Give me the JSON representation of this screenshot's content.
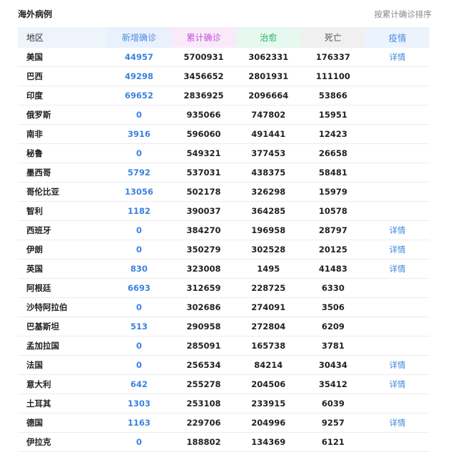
{
  "header": {
    "title": "海外病例",
    "sort_label": "按累计确诊排序"
  },
  "columns": {
    "region": "地区",
    "new": "新增确诊",
    "total": "累计确诊",
    "cured": "治愈",
    "dead": "死亡",
    "detail": "疫情"
  },
  "colors": {
    "accent_blue": "#3b82e0",
    "total_purple": "#c352d8",
    "cured_green": "#27b36a"
  },
  "rows": [
    {
      "region": "美国",
      "new": "44957",
      "total": "5700931",
      "cured": "3062331",
      "dead": "176337",
      "detail": "详情"
    },
    {
      "region": "巴西",
      "new": "49298",
      "total": "3456652",
      "cured": "2801931",
      "dead": "111100",
      "detail": ""
    },
    {
      "region": "印度",
      "new": "69652",
      "total": "2836925",
      "cured": "2096664",
      "dead": "53866",
      "detail": ""
    },
    {
      "region": "俄罗斯",
      "new": "0",
      "total": "935066",
      "cured": "747802",
      "dead": "15951",
      "detail": ""
    },
    {
      "region": "南非",
      "new": "3916",
      "total": "596060",
      "cured": "491441",
      "dead": "12423",
      "detail": ""
    },
    {
      "region": "秘鲁",
      "new": "0",
      "total": "549321",
      "cured": "377453",
      "dead": "26658",
      "detail": ""
    },
    {
      "region": "墨西哥",
      "new": "5792",
      "total": "537031",
      "cured": "438375",
      "dead": "58481",
      "detail": ""
    },
    {
      "region": "哥伦比亚",
      "new": "13056",
      "total": "502178",
      "cured": "326298",
      "dead": "15979",
      "detail": ""
    },
    {
      "region": "智利",
      "new": "1182",
      "total": "390037",
      "cured": "364285",
      "dead": "10578",
      "detail": ""
    },
    {
      "region": "西班牙",
      "new": "0",
      "total": "384270",
      "cured": "196958",
      "dead": "28797",
      "detail": "详情"
    },
    {
      "region": "伊朗",
      "new": "0",
      "total": "350279",
      "cured": "302528",
      "dead": "20125",
      "detail": "详情"
    },
    {
      "region": "英国",
      "new": "830",
      "total": "323008",
      "cured": "1495",
      "dead": "41483",
      "detail": "详情"
    },
    {
      "region": "阿根廷",
      "new": "6693",
      "total": "312659",
      "cured": "228725",
      "dead": "6330",
      "detail": ""
    },
    {
      "region": "沙特阿拉伯",
      "new": "0",
      "total": "302686",
      "cured": "274091",
      "dead": "3506",
      "detail": ""
    },
    {
      "region": "巴基斯坦",
      "new": "513",
      "total": "290958",
      "cured": "272804",
      "dead": "6209",
      "detail": ""
    },
    {
      "region": "孟加拉国",
      "new": "0",
      "total": "285091",
      "cured": "165738",
      "dead": "3781",
      "detail": ""
    },
    {
      "region": "法国",
      "new": "0",
      "total": "256534",
      "cured": "84214",
      "dead": "30434",
      "detail": "详情"
    },
    {
      "region": "意大利",
      "new": "642",
      "total": "255278",
      "cured": "204506",
      "dead": "35412",
      "detail": "详情"
    },
    {
      "region": "土耳其",
      "new": "1303",
      "total": "253108",
      "cured": "233915",
      "dead": "6039",
      "detail": ""
    },
    {
      "region": "德国",
      "new": "1163",
      "total": "229706",
      "cured": "204996",
      "dead": "9257",
      "detail": "详情"
    },
    {
      "region": "伊拉克",
      "new": "0",
      "total": "188802",
      "cured": "134369",
      "dead": "6121",
      "detail": ""
    }
  ]
}
